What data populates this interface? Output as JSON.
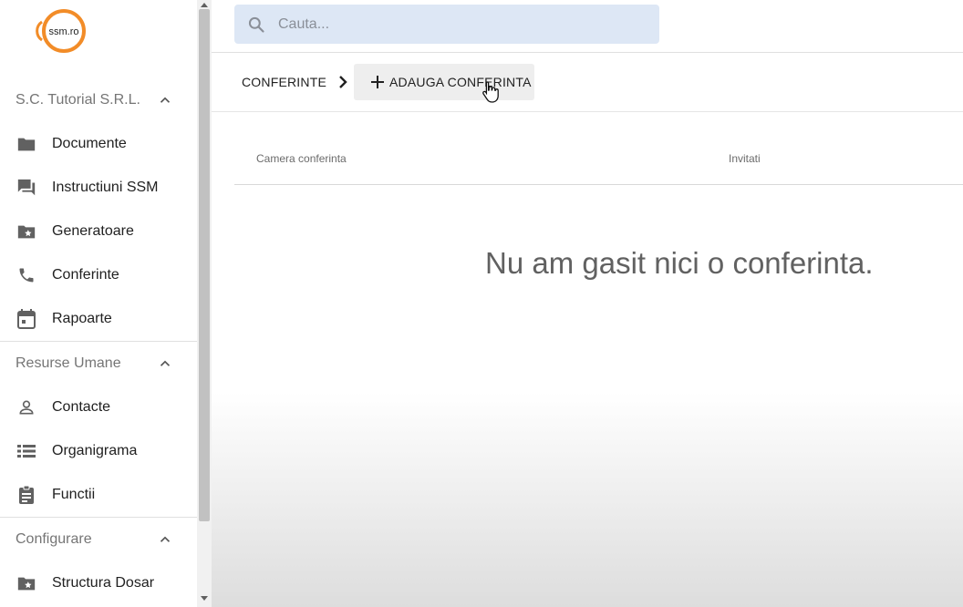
{
  "brand": {
    "logo_text": "ssm.ro",
    "accent": "#f28c28"
  },
  "search": {
    "placeholder": "Cauta...",
    "value": ""
  },
  "sidebar": {
    "sections": [
      {
        "title": "S.C. Tutorial S.R.L.",
        "items": [
          {
            "label": "Documente",
            "icon": "folder-icon"
          },
          {
            "label": "Instructiuni SSM",
            "icon": "forum-icon"
          },
          {
            "label": "Generatoare",
            "icon": "folder-star-icon"
          },
          {
            "label": "Conferinte",
            "icon": "phone-icon"
          },
          {
            "label": "Rapoarte",
            "icon": "calendar-icon"
          }
        ]
      },
      {
        "title": "Resurse Umane",
        "items": [
          {
            "label": "Contacte",
            "icon": "person-icon"
          },
          {
            "label": "Organigrama",
            "icon": "list-icon"
          },
          {
            "label": "Functii",
            "icon": "clipboard-icon"
          }
        ]
      },
      {
        "title": "Configurare",
        "items": [
          {
            "label": "Structura Dosar",
            "icon": "folder-star-icon"
          }
        ]
      }
    ]
  },
  "breadcrumb": {
    "current": "CONFERINTE",
    "add_button": "ADAUGA CONFERINTA"
  },
  "table": {
    "columns": [
      "Camera conferinta",
      "Invitati"
    ]
  },
  "empty_message": "Nu am gasit nici o conferinta."
}
